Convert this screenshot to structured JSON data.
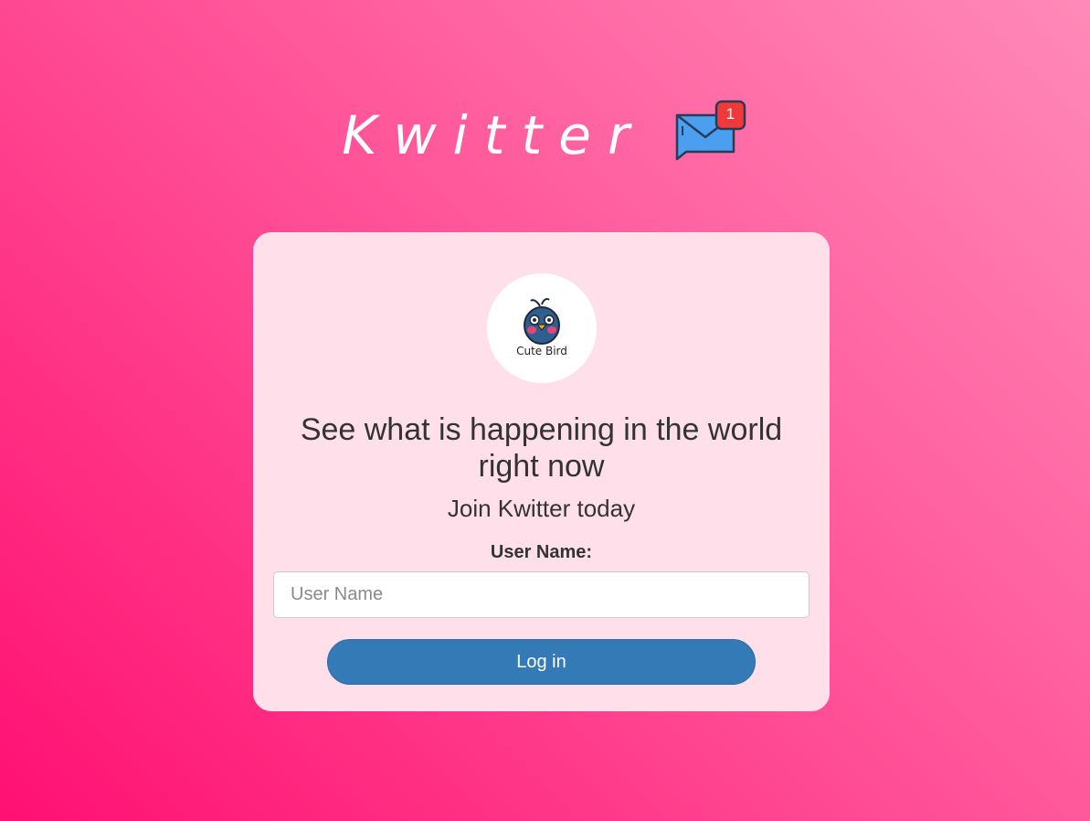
{
  "brand": {
    "title": "Kwitter",
    "notification_count": "1"
  },
  "card": {
    "avatar_caption": "Cute Bird",
    "headline": "See what is happening in the world right now",
    "subline": "Join Kwitter today",
    "username_label": "User Name:",
    "username_placeholder": "User Name",
    "username_value": "",
    "login_label": "Log in"
  },
  "colors": {
    "background_start": "#ff1072",
    "background_end": "#ff8ab8",
    "card_background": "#ffdfe9",
    "button": "#337ab7",
    "mail_icon": "#4a9ff0",
    "notification_badge": "#f03a3a"
  },
  "icons": {
    "brand_icon": "mail-notification-icon",
    "avatar": "cute-bird-logo"
  }
}
